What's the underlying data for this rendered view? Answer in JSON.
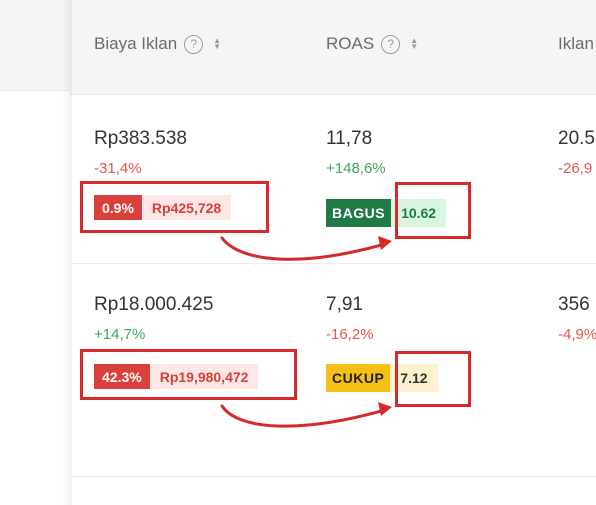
{
  "colors": {
    "negative": "#e0584a",
    "positive": "#3aa757",
    "annotation_red": "#d62a2a",
    "badge_good": "#1f7a45",
    "badge_ok": "#f5bf17"
  },
  "header": {
    "columns": [
      {
        "label": "Biaya Iklan",
        "help_icon": "?",
        "sort_icon": "sort-icon"
      },
      {
        "label": "ROAS",
        "help_icon": "?",
        "sort_icon": "sort-icon"
      },
      {
        "label": "Iklan"
      }
    ]
  },
  "rows": [
    {
      "ad_cost": "Rp383.538",
      "ad_cost_change": "-31,4%",
      "ad_cost_share_pct": "0.9%",
      "ad_cost_share_amount": "Rp425,728",
      "roas": "11,78",
      "roas_change": "+148,6%",
      "roas_badge_label": "BAGUS",
      "roas_badge_value": "10.62",
      "next_value": "20.5",
      "next_change": "-26,9"
    },
    {
      "ad_cost": "Rp18.000.425",
      "ad_cost_change": "+14,7%",
      "ad_cost_share_pct": "42.3%",
      "ad_cost_share_amount": "Rp19,980,472",
      "roas": "7,91",
      "roas_change": "-16,2%",
      "roas_badge_label": "CUKUP",
      "roas_badge_value": "7.12",
      "next_value": "356",
      "next_change": "-4,9%"
    }
  ]
}
